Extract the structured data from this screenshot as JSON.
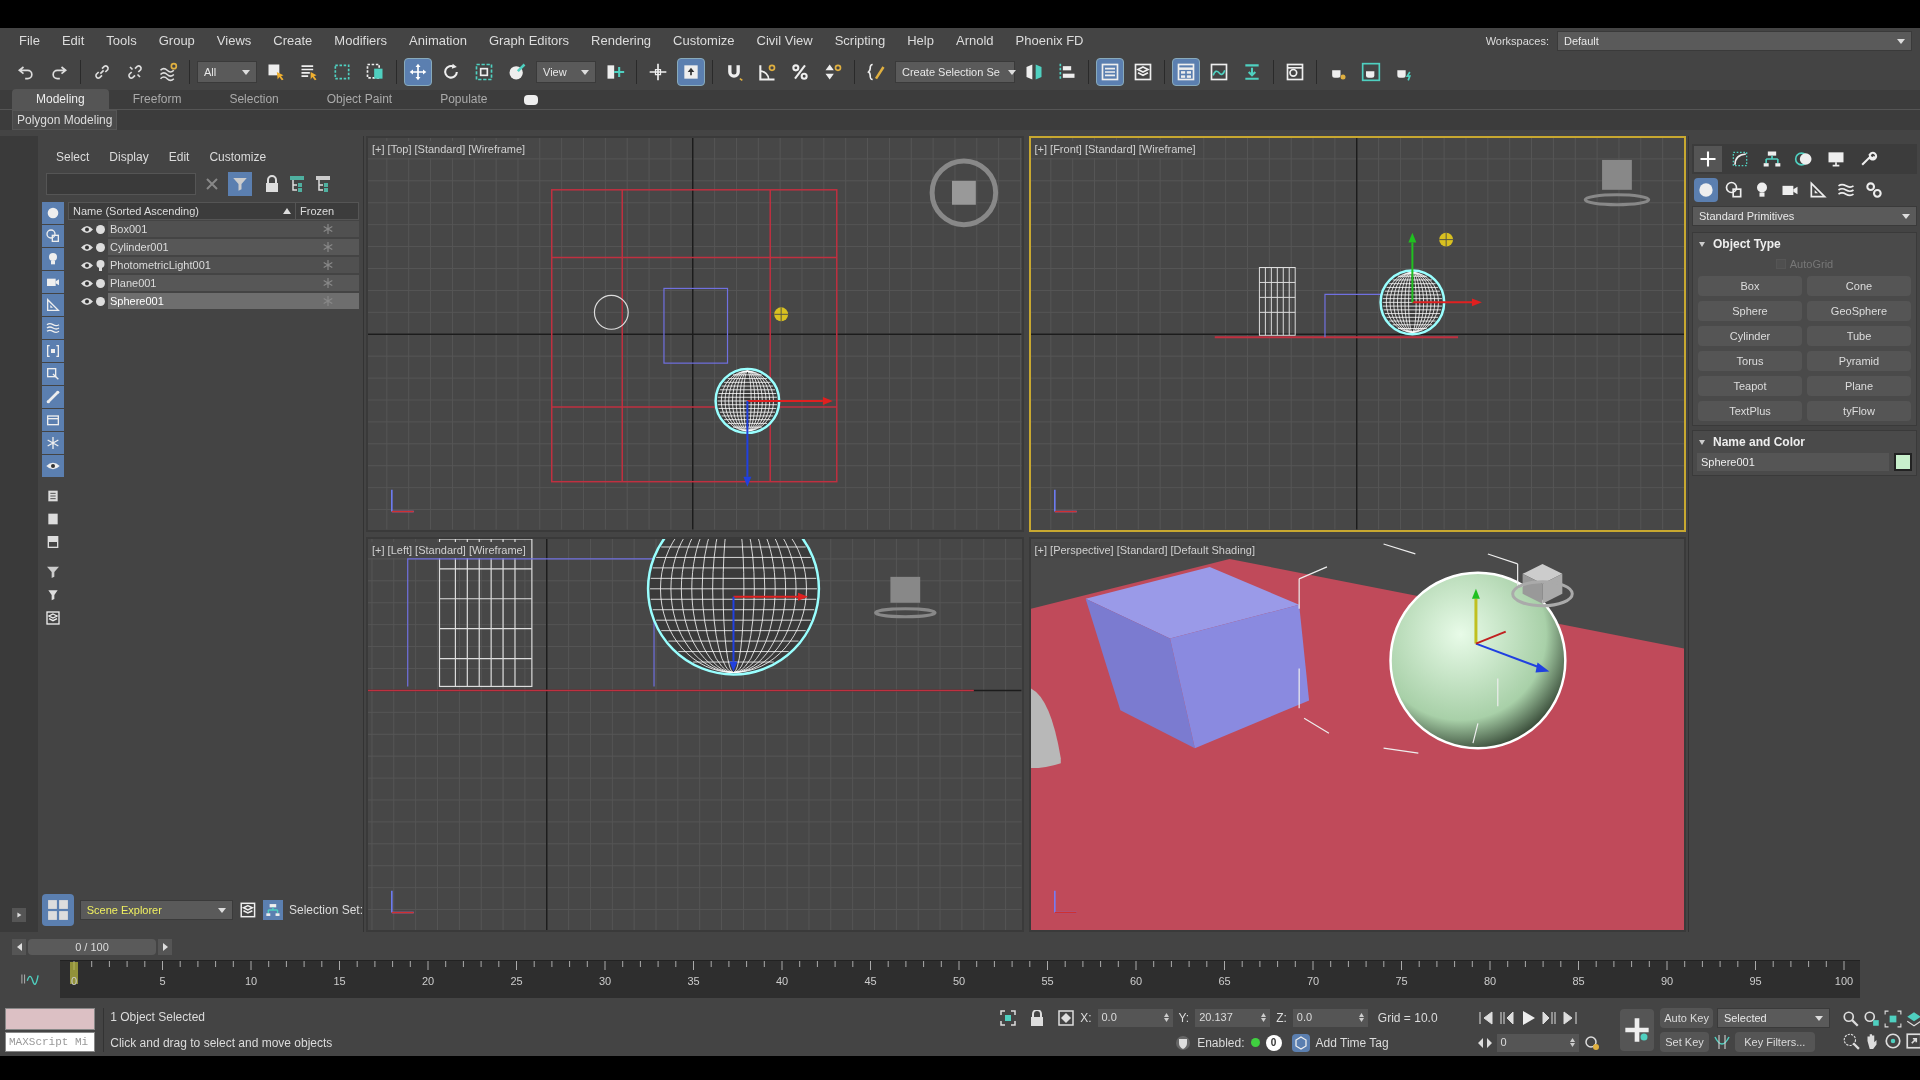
{
  "menu": [
    "File",
    "Edit",
    "Tools",
    "Group",
    "Views",
    "Create",
    "Modifiers",
    "Animation",
    "Graph Editors",
    "Rendering",
    "Customize",
    "Civil View",
    "Scripting",
    "Help",
    "Arnold",
    "Phoenix FD"
  ],
  "workspaces": {
    "label": "Workspaces:",
    "value": "Default"
  },
  "toolbar": [
    {
      "kind": "undo",
      "selected": false
    },
    {
      "kind": "redo",
      "selected": false
    },
    {
      "kind": "sep"
    },
    {
      "kind": "link",
      "selected": false
    },
    {
      "kind": "unlink",
      "selected": false
    },
    {
      "kind": "bind",
      "selected": false
    },
    {
      "kind": "sep"
    },
    {
      "kind": "dropdown",
      "value": "All"
    },
    {
      "kind": "select",
      "selected": false
    },
    {
      "kind": "select-by-name",
      "selected": false
    },
    {
      "kind": "region",
      "selected": false
    },
    {
      "kind": "crossing",
      "selected": false
    },
    {
      "kind": "sep"
    },
    {
      "kind": "move",
      "selected": true
    },
    {
      "kind": "rotate",
      "selected": false
    },
    {
      "kind": "scale",
      "selected": false
    },
    {
      "kind": "placement",
      "selected": false
    },
    {
      "kind": "dropdown",
      "value": "View"
    },
    {
      "kind": "pivot",
      "selected": false
    },
    {
      "kind": "sep"
    },
    {
      "kind": "crosshair",
      "selected": false
    },
    {
      "kind": "keyboard",
      "selected": true
    },
    {
      "kind": "sep"
    },
    {
      "kind": "snap",
      "selected": false
    },
    {
      "kind": "angle-snap",
      "selected": false
    },
    {
      "kind": "percent-snap",
      "selected": false
    },
    {
      "kind": "spinner-snap",
      "selected": false
    },
    {
      "kind": "sep"
    },
    {
      "kind": "named-sets",
      "selected": false
    },
    {
      "kind": "dropdown",
      "value": "Create Selection Se"
    },
    {
      "kind": "mirror",
      "selected": false
    },
    {
      "kind": "align",
      "selected": false
    },
    {
      "kind": "sep"
    },
    {
      "kind": "scene-explorer",
      "selected": true
    },
    {
      "kind": "layers",
      "selected": false
    },
    {
      "kind": "sep"
    },
    {
      "kind": "ribbon",
      "selected": true
    },
    {
      "kind": "curve-editor",
      "selected": false
    },
    {
      "kind": "schematic",
      "selected": false
    },
    {
      "kind": "sep"
    },
    {
      "kind": "material",
      "selected": false
    },
    {
      "kind": "sep"
    },
    {
      "kind": "render-setup",
      "selected": false
    },
    {
      "kind": "rendered-frame",
      "selected": false
    },
    {
      "kind": "render",
      "selected": false
    }
  ],
  "ribbon_tabs": [
    {
      "label": "Modeling",
      "selected": true
    },
    {
      "label": "Freeform",
      "selected": false
    },
    {
      "label": "Selection",
      "selected": false
    },
    {
      "label": "Object Paint",
      "selected": false
    },
    {
      "label": "Populate",
      "selected": false
    }
  ],
  "ribbon_panel": "Polygon Modeling",
  "scene_explorer": {
    "menu": [
      "Select",
      "Display",
      "Edit",
      "Customize"
    ],
    "filters": [
      {
        "kind": "geometry",
        "selected": true
      },
      {
        "kind": "shapes",
        "selected": true
      },
      {
        "kind": "lights",
        "selected": true
      },
      {
        "kind": "cameras",
        "selected": true
      },
      {
        "kind": "helpers",
        "selected": true
      },
      {
        "kind": "spacewarps",
        "selected": true
      },
      {
        "kind": "groups",
        "selected": true
      },
      {
        "kind": "xrefs",
        "selected": true
      },
      {
        "kind": "bones",
        "selected": true
      },
      {
        "kind": "containers",
        "selected": true
      },
      {
        "kind": "frozen",
        "selected": true
      },
      {
        "kind": "hidden",
        "selected": true
      },
      {
        "kind": "all",
        "selected": false
      },
      {
        "kind": "none",
        "selected": false
      },
      {
        "kind": "invert",
        "selected": false
      },
      {
        "kind": "filter",
        "selected": false
      },
      {
        "kind": "funnel",
        "selected": false
      },
      {
        "kind": "layers",
        "selected": false
      }
    ],
    "columns": [
      "Name (Sorted Ascending)",
      "Frozen"
    ],
    "rows": [
      {
        "name": "Box001",
        "kind": "geometry",
        "selected": false
      },
      {
        "name": "Cylinder001",
        "kind": "geometry",
        "selected": false
      },
      {
        "name": "PhotometricLight001",
        "kind": "light",
        "selected": false
      },
      {
        "name": "Plane001",
        "kind": "geometry",
        "selected": false
      },
      {
        "name": "Sphere001",
        "kind": "geometry",
        "selected": true
      }
    ],
    "explorer_name": "Scene Explorer",
    "selection_set_label": "Selection Set:"
  },
  "viewports": [
    {
      "label": "[+] [Top] [Standard] [Wireframe]",
      "kind": "top",
      "active": false
    },
    {
      "label": "[+] [Front] [Standard] [Wireframe]",
      "kind": "front",
      "active": true
    },
    {
      "label": "[+] [Left] [Standard] [Wireframe]",
      "kind": "left",
      "active": false
    },
    {
      "label": "[+] [Perspective] [Standard] [Default Shading]",
      "kind": "perspective",
      "active": false
    }
  ],
  "command_panel": {
    "tabs": [
      {
        "kind": "create",
        "selected": true
      },
      {
        "kind": "modify",
        "selected": false
      },
      {
        "kind": "hierarchy",
        "selected": false
      },
      {
        "kind": "motion",
        "selected": false
      },
      {
        "kind": "display",
        "selected": false
      },
      {
        "kind": "utilities",
        "selected": false
      }
    ],
    "categories": [
      {
        "kind": "geometry",
        "selected": true
      },
      {
        "kind": "shapes",
        "selected": false
      },
      {
        "kind": "lights",
        "selected": false
      },
      {
        "kind": "cameras",
        "selected": false
      },
      {
        "kind": "helpers",
        "selected": false
      },
      {
        "kind": "spacewarps",
        "selected": false
      },
      {
        "kind": "systems",
        "selected": false
      }
    ],
    "dropdown": "Standard Primitives",
    "object_type": {
      "title": "Object Type",
      "autogrid": {
        "label": "AutoGrid",
        "checked": false,
        "disabled": true
      },
      "buttons": [
        "Box",
        "Cone",
        "Sphere",
        "GeoSphere",
        "Cylinder",
        "Tube",
        "Torus",
        "Pyramid",
        "Teapot",
        "Plane",
        "TextPlus",
        "tyFlow"
      ]
    },
    "name_and_color": {
      "title": "Name and Color",
      "name": "Sphere001",
      "color": "#c8f0cc"
    }
  },
  "time_slider": {
    "label": "0 / 100"
  },
  "ruler_ticks": [
    "0",
    "5",
    "10",
    "15",
    "20",
    "25",
    "30",
    "35",
    "40",
    "45",
    "50",
    "55",
    "60",
    "65",
    "70",
    "75",
    "80",
    "85",
    "90",
    "95",
    "100"
  ],
  "status": {
    "selected": "1 Object Selected",
    "prompt": "Click and drag to select and move objects",
    "maxscript": "MAXScript Mi"
  },
  "coords": {
    "fields": [
      {
        "label": "X:",
        "value": "0.0"
      },
      {
        "label": "Y:",
        "value": "20.137"
      },
      {
        "label": "Z:",
        "value": "0.0"
      }
    ],
    "grid": "Grid = 10.0"
  },
  "time_tag": {
    "enabled_label": "Enabled:",
    "enabled": true,
    "count": "0",
    "add": "Add Time Tag"
  },
  "playback": {
    "frame": "0",
    "auto_key": "Auto Key",
    "set_key": "Set Key",
    "key_mode": "Selected",
    "key_filters": "Key Filters..."
  }
}
